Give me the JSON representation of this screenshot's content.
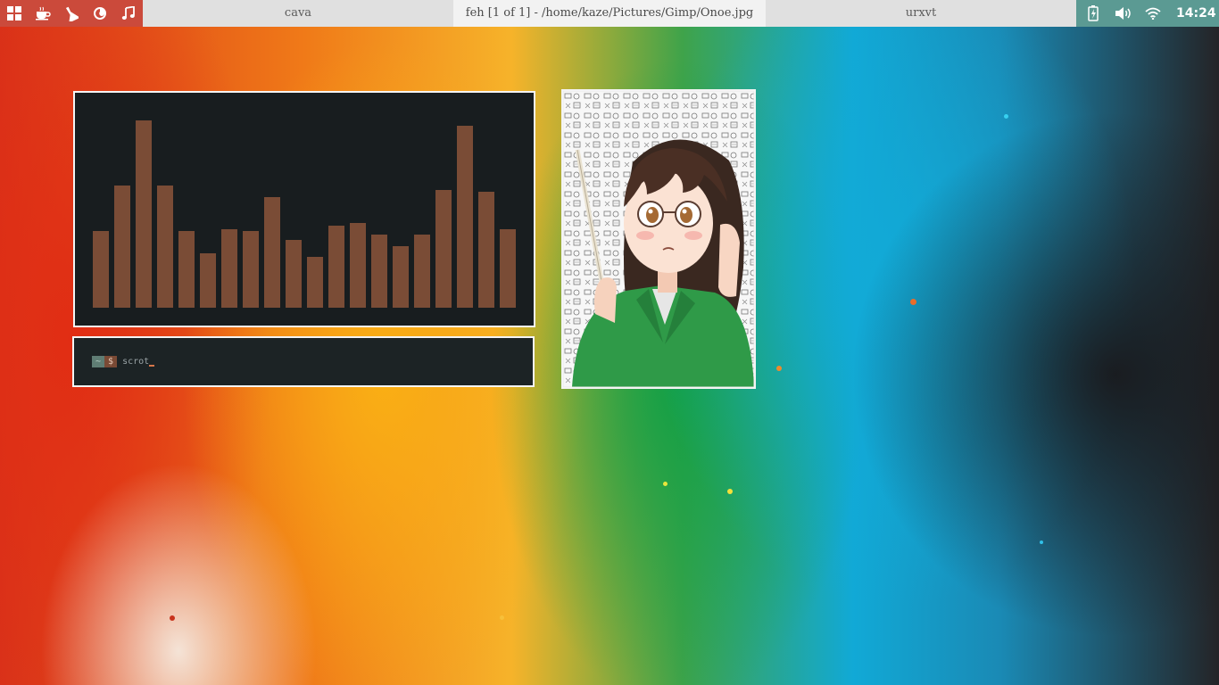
{
  "launcher": {
    "items": [
      {
        "name": "apps-grid-icon"
      },
      {
        "name": "coffee-cup-icon"
      },
      {
        "name": "flask-icon"
      },
      {
        "name": "firefox-icon"
      },
      {
        "name": "music-note-icon"
      }
    ]
  },
  "taskbar": {
    "tasks": [
      {
        "label": "cava"
      },
      {
        "label": "feh [1 of 1] - /home/kaze/Pictures/Gimp/Onoe.jpg"
      },
      {
        "label": "urxvt"
      }
    ]
  },
  "tray": {
    "battery_icon": "battery-charging-icon",
    "volume_icon": "volume-icon",
    "wifi_icon": "wifi-icon",
    "clock": "14:24"
  },
  "cava": {
    "bar_color": "#7a4c36",
    "levels": [
      0.41,
      0.65,
      1.0,
      0.65,
      0.41,
      0.29,
      0.42,
      0.41,
      0.59,
      0.36,
      0.27,
      0.44,
      0.45,
      0.39,
      0.33,
      0.39,
      0.63,
      0.97,
      0.62,
      0.42
    ]
  },
  "terminal": {
    "prompt_dir": "~",
    "prompt_sign": "$",
    "command": "scrot"
  },
  "colors": {
    "launcher_bg": "#cb4a3b",
    "tray_bg": "#5b9a93",
    "taskbar_bg": "#e0e0e0",
    "active_task_bg": "#f2f2f2",
    "terminal_bg": "#181d1f"
  }
}
